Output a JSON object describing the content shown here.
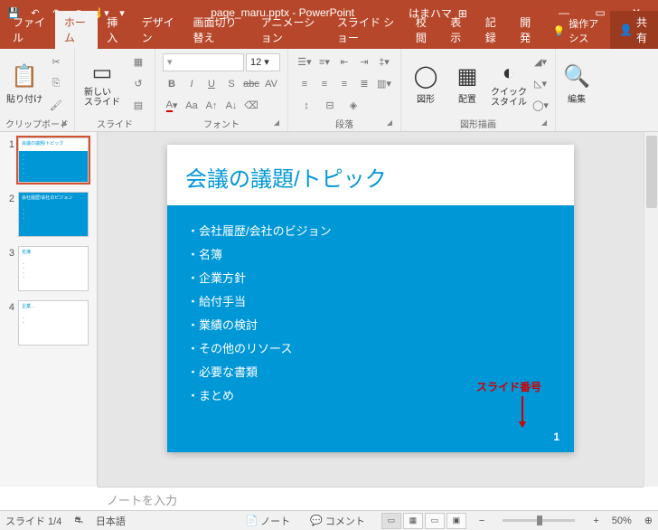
{
  "titlebar": {
    "filename": "page_maru.pptx",
    "app": "PowerPoint",
    "user": "はまハマ"
  },
  "tabs": {
    "file": "ファイル",
    "home": "ホーム",
    "insert": "挿入",
    "design": "デザイン",
    "transitions": "画面切り替え",
    "animations": "アニメーション",
    "slideshow": "スライド ショー",
    "review": "校閲",
    "view": "表示",
    "record": "記録",
    "developer": "開発",
    "tellme": "操作アシス",
    "share": "共有"
  },
  "ribbon": {
    "clipboard": {
      "label": "クリップボード",
      "paste": "貼り付け"
    },
    "slides": {
      "label": "スライド",
      "newslide": "新しい\nスライド"
    },
    "font": {
      "label": "フォント",
      "size": "12"
    },
    "paragraph": {
      "label": "段落"
    },
    "drawing": {
      "label": "図形描画",
      "shapes": "図形",
      "arrange": "配置",
      "quickstyle": "クイック\nスタイル"
    },
    "editing": {
      "label": "編集",
      "edit": "編集"
    }
  },
  "thumbs": [
    {
      "num": "1",
      "title": "会議の議題/トピック"
    },
    {
      "num": "2",
      "title": "会社履歴/会社のビジョン"
    },
    {
      "num": "3",
      "title": "名簿"
    },
    {
      "num": "4",
      "title": "企業…"
    }
  ],
  "slide": {
    "title": "会議の議題/トピック",
    "bullets": [
      "会社履歴/会社のビジョン",
      "名簿",
      "企業方針",
      "給付手当",
      "業績の検討",
      "その他のリソース",
      "必要な書類",
      "まとめ"
    ],
    "number": "1",
    "annotation": "スライド番号"
  },
  "notes": {
    "placeholder": "ノートを入力"
  },
  "status": {
    "slide_indicator": "スライド 1/4",
    "lang": "日本語",
    "notes": "ノート",
    "comments": "コメント",
    "zoom": "50%"
  }
}
